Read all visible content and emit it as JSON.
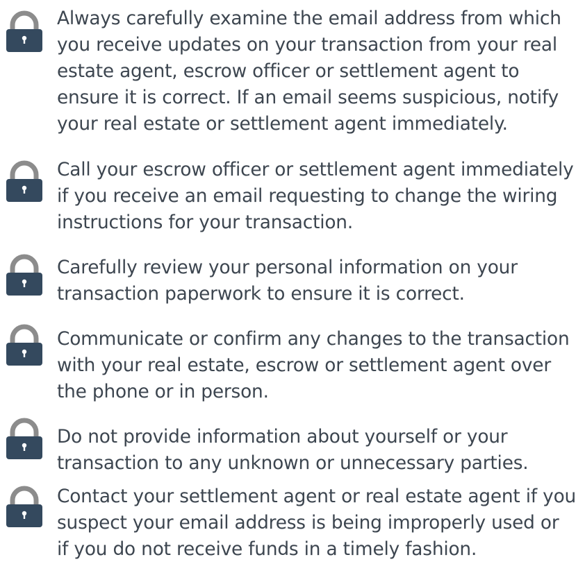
{
  "colors": {
    "text": "#3d4650",
    "lock_shackle": "#8c8c8c",
    "lock_body": "#34495e",
    "lock_keyhole": "#ffffff"
  },
  "tips": [
    {
      "icon": "padlock-icon",
      "text": "Always carefully examine the email address from which\nyou receive updates on your transaction from your real\nestate agent, escrow officer or settlement agent to\nensure it is correct. If an email seems suspicious, notify\nyour real estate or settlement agent immediately."
    },
    {
      "icon": "padlock-icon",
      "text": "Call your escrow officer or settlement agent immediately\nif you receive an email requesting to change the wiring\ninstructions for your transaction."
    },
    {
      "icon": "padlock-icon",
      "text": "Carefully review your personal information on your\ntransaction paperwork to ensure it is correct."
    },
    {
      "icon": "padlock-icon",
      "text": "Communicate or confirm any changes to the transaction\nwith your real estate, escrow or settlement agent over\nthe phone or in person."
    },
    {
      "icon": "padlock-icon",
      "text": "Do not provide information about yourself or your\ntransaction to any unknown or unnecessary parties."
    },
    {
      "icon": "padlock-icon",
      "text": "Contact your settlement agent or real estate agent if you\nsuspect your email address is being improperly used or\nif you do not receive funds in a timely fashion."
    }
  ]
}
